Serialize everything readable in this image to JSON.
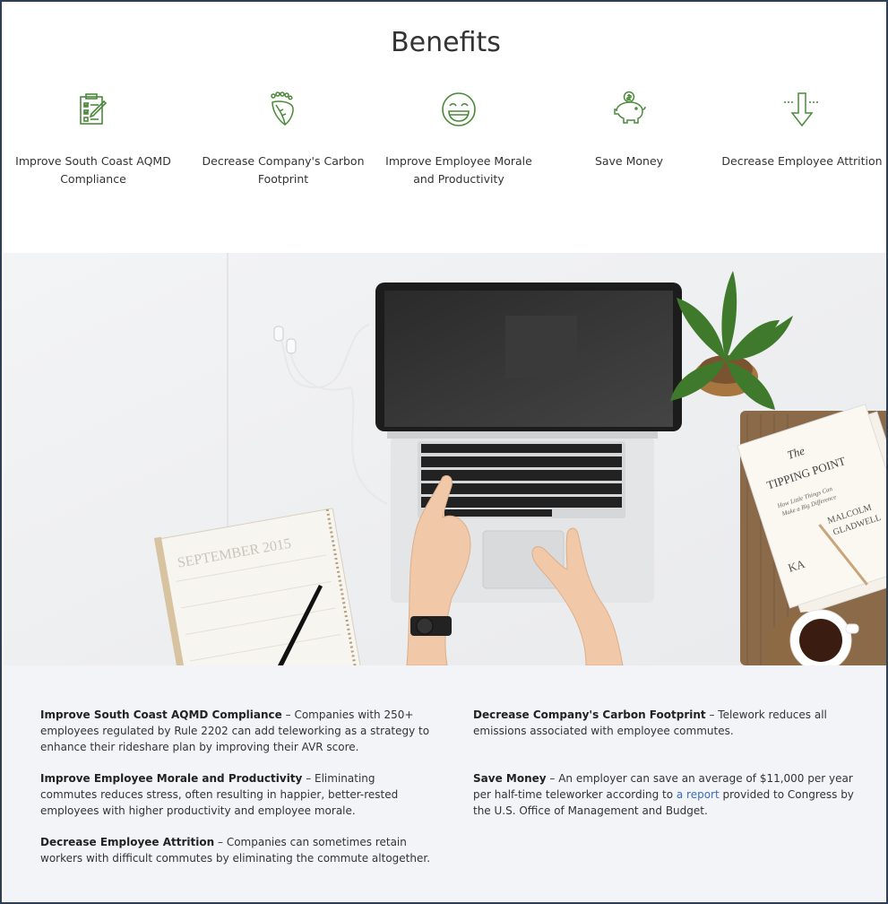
{
  "section_title": "Benefits",
  "benefits": [
    {
      "icon": "checklist-icon",
      "label": "Improve South Coast AQMD Compliance"
    },
    {
      "icon": "footprint-leaf-icon",
      "label": "Decrease Company's Carbon Footprint"
    },
    {
      "icon": "smiley-face-icon",
      "label": "Improve Employee Morale and Productivity"
    },
    {
      "icon": "piggy-bank-icon",
      "label": "Save Money"
    },
    {
      "icon": "down-arrow-icon",
      "label": "Decrease Employee Attrition"
    }
  ],
  "hero": {
    "calendar_text": "SEPTEMBER 2015",
    "book_text": [
      "The",
      "TIPPING POINT",
      "How Little Things Can",
      "Make a Big Difference",
      "MALCOLM",
      "GLADWELL",
      "KA"
    ]
  },
  "details": [
    {
      "heading": "Improve South Coast AQMD Compliance",
      "sep": " – ",
      "text": "Companies with 250+ employees regulated by Rule 2202 can add teleworking as a strategy to enhance their rideshare plan by improving their AVR score."
    },
    {
      "heading": "Decrease Company's Carbon Footprint",
      "sep": " – ",
      "text": "Telework reduces all emissions associated with employee commutes."
    },
    {
      "heading": "Improve Employee Morale and Productivity",
      "sep": " – ",
      "text": "Eliminating commutes reduces stress, often resulting in happier, better-rested employees with higher productivity and employee morale."
    },
    {
      "heading": "Save Money",
      "sep": " – ",
      "text": "An employer can save an average of $11,000 per year per half-time teleworker according to ",
      "link": "a report",
      "text_after": " provided to Congress by the U.S. Office of Management and Budget."
    },
    {
      "heading": "Decrease Employee Attrition",
      "sep": " – ",
      "text": "Companies can sometimes retain workers with difficult commutes by eliminating the commute altogether."
    }
  ],
  "colors": {
    "icon_green": "#4a8a3a",
    "link_blue": "#3a6dc4",
    "bottom_bg": "#f2f4f8",
    "border": "#2f3e52"
  }
}
